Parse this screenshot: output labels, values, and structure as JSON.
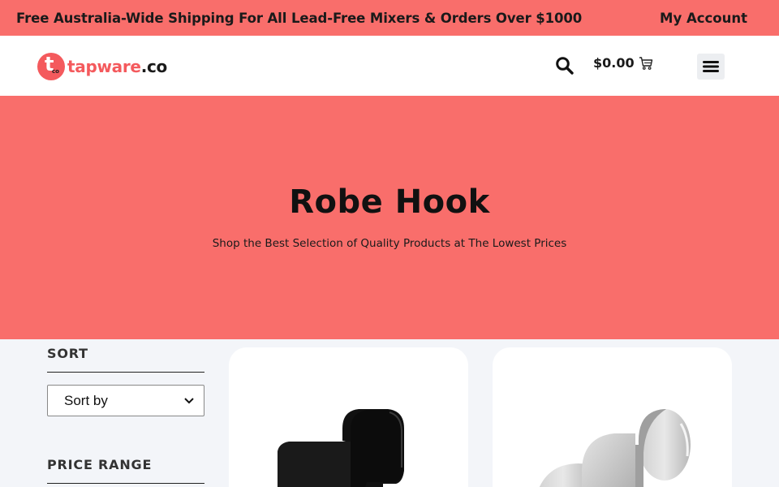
{
  "topbar": {
    "shipping_text": "Free Australia-Wide Shipping For All Lead-Free Mixers & Orders Over $1000",
    "account_label": "My Account",
    "background": "#f96e6b"
  },
  "header": {
    "logo": {
      "mark_letter": "t",
      "mark_suffix": "co",
      "word": "tapware",
      "suffix": ".co",
      "color": "#f45a5d"
    },
    "search_icon": "search-icon",
    "cart": {
      "total": "$0.00",
      "icon": "cart-icon"
    },
    "menu_icon": "hamburger-menu-icon"
  },
  "hero": {
    "title": "Robe Hook",
    "subtitle": "Shop the Best Selection of Quality Products at The Lowest Prices"
  },
  "sidebar": {
    "sort_heading": "SORT",
    "sort_select_value": "Sort by",
    "price_heading": "PRICE RANGE"
  },
  "products": [
    {
      "finish": "black"
    },
    {
      "finish": "brushed-nickel"
    }
  ]
}
